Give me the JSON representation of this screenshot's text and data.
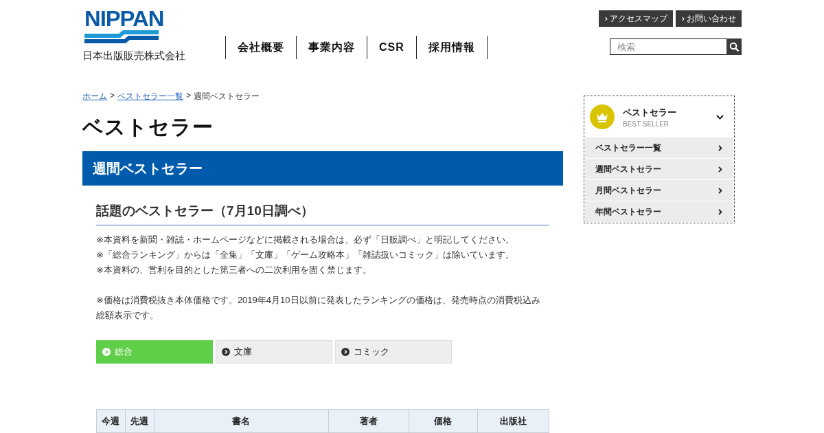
{
  "header": {
    "logo_text": "NIPPAN",
    "company_name": "日本出版販売株式会社",
    "nav": [
      "会社概要",
      "事業内容",
      "CSR",
      "採用情報"
    ],
    "utility_links": [
      "アクセスマップ",
      "お問い合わせ"
    ],
    "search": {
      "placeholder": "検索"
    }
  },
  "breadcrumb": {
    "links": [
      "ホーム",
      "ベストセラー一覧"
    ],
    "separator": ">",
    "current": "週間ベストセラー"
  },
  "page_title": "ベストセラー",
  "section_band": "週間ベストセラー",
  "subsection_title": "話題のベストセラー（7月10日調べ）",
  "notes": [
    "※本資料を新聞・雑誌・ホームページなどに掲載される場合は、必ず「日販調べ」と明記してください。",
    "※「総合ランキング」からは「全集」「文庫」「ゲーム攻略本」「雑誌扱いコミック」は除いています。",
    "※本資料の、営利を目的とした第三者への二次利用を固く禁じます。"
  ],
  "price_note": "※価格は消費税抜き本体価格です。2019年4月10日以前に発表したランキングの価格は、発売時点の消費税込み総額表示です。",
  "tabs": [
    {
      "label": "総合",
      "selected": true
    },
    {
      "label": "文庫",
      "selected": false
    },
    {
      "label": "コミック",
      "selected": false
    }
  ],
  "table": {
    "columns": [
      "今週",
      "先週",
      "書名",
      "著者",
      "価格",
      "出版社"
    ]
  },
  "sidebar": {
    "title": "ベストセラー",
    "subtitle": "BEST SELLER",
    "expanded": true,
    "items": [
      "ベストセラー一覧",
      "週間ベストセラー",
      "月間ベストセラー",
      "年間ベストセラー"
    ]
  }
}
